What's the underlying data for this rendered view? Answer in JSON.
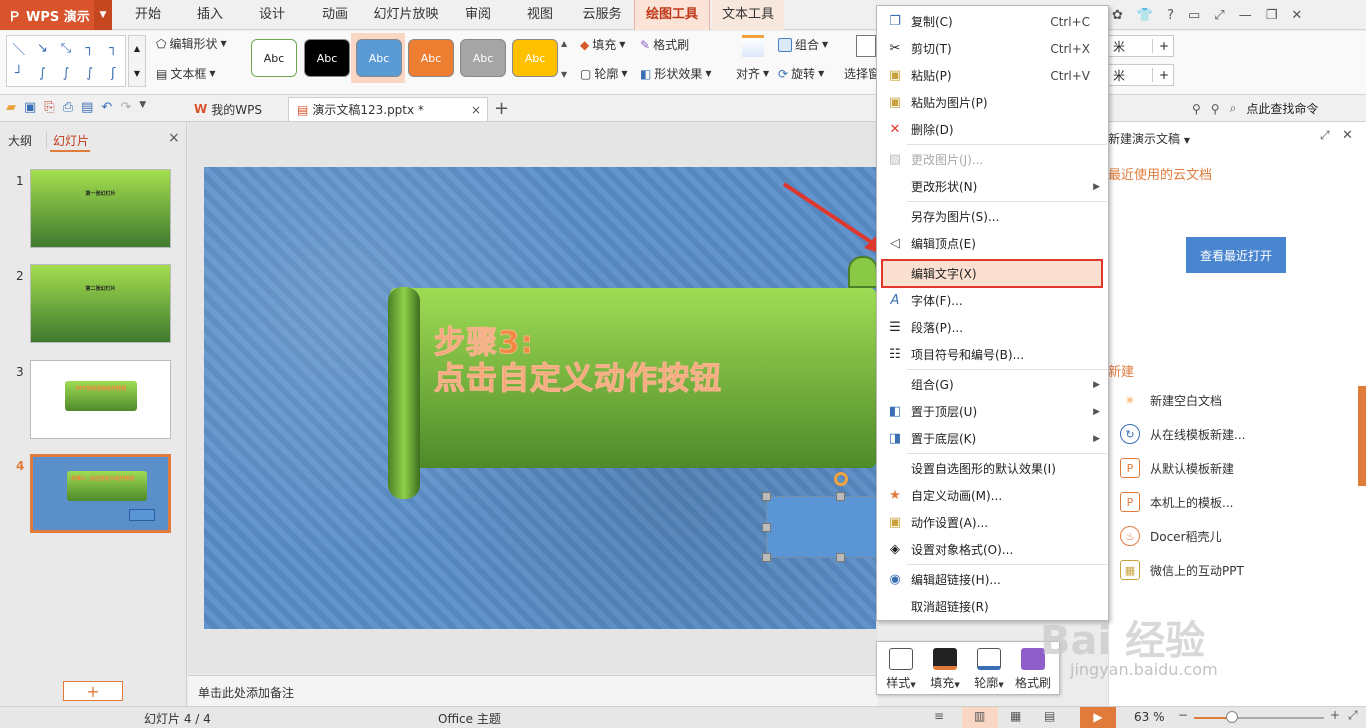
{
  "app": {
    "logo": "WPS 演示"
  },
  "menubar": {
    "tabs": [
      "开始",
      "插入",
      "设计",
      "动画",
      "幻灯片放映",
      "审阅",
      "视图",
      "云服务",
      "绘图工具",
      "文本工具"
    ]
  },
  "ribbon": {
    "edit_shape": "编辑形状",
    "textbox": "文本框",
    "styles": [
      "Abc",
      "Abc",
      "Abc",
      "Abc",
      "Abc",
      "Abc"
    ],
    "fill": "填充",
    "format_painter": "格式刷",
    "outline": "轮廓",
    "shape_effect": "形状效果",
    "align": "对齐",
    "group": "组合",
    "rotate": "旋转",
    "select": "选择窗",
    "unit1": "米",
    "unit2": "米",
    "plus": "+"
  },
  "tabstrip": {
    "mywps": "我的WPS",
    "doc": "演示文稿123.pptx *",
    "close": "×",
    "add": "+",
    "search": "点此查找命令"
  },
  "leftpanel": {
    "tab_outline": "大纲",
    "tab_slides": "幻灯片",
    "close": "×",
    "slides": [
      {
        "num": "1",
        "text": "第一张幻灯片"
      },
      {
        "num": "2",
        "text": "第二张幻灯片"
      },
      {
        "num": "3",
        "text": "PPT如何添加动作按钮"
      },
      {
        "num": "4",
        "text": "步骤3：点击自定义动作按钮"
      }
    ],
    "add": "+"
  },
  "slide": {
    "line1": "步骤3:",
    "line2": "点击自定义动作按钮"
  },
  "notes": {
    "placeholder": "单击此处添加备注"
  },
  "rightpanel": {
    "new_doc": "新建演示文稿",
    "recent_cloud": "最近使用的云文档",
    "view_recent": "查看最近打开",
    "new_section": "新建",
    "items": [
      "新建空白文档",
      "从在线模板新建...",
      "从默认模板新建",
      "本机上的模板...",
      "Docer稻壳儿",
      "微信上的互动PPT"
    ]
  },
  "ctxmenu": {
    "items": [
      {
        "label": "复制(C)",
        "shortcut": "Ctrl+C"
      },
      {
        "label": "剪切(T)",
        "shortcut": "Ctrl+X"
      },
      {
        "label": "粘贴(P)",
        "shortcut": "Ctrl+V"
      },
      {
        "label": "粘贴为图片(P)"
      },
      {
        "label": "删除(D)"
      },
      {
        "label": "更改图片(J)..."
      },
      {
        "label": "更改形状(N)"
      },
      {
        "label": "另存为图片(S)..."
      },
      {
        "label": "编辑顶点(E)"
      },
      {
        "label": "编辑文字(X)"
      },
      {
        "label": "字体(F)..."
      },
      {
        "label": "段落(P)..."
      },
      {
        "label": "项目符号和编号(B)..."
      },
      {
        "label": "组合(G)"
      },
      {
        "label": "置于顶层(U)"
      },
      {
        "label": "置于底层(K)"
      },
      {
        "label": "设置自选图形的默认效果(I)"
      },
      {
        "label": "自定义动画(M)..."
      },
      {
        "label": "动作设置(A)..."
      },
      {
        "label": "设置对象格式(O)..."
      },
      {
        "label": "编辑超链接(H)..."
      },
      {
        "label": "取消超链接(R)"
      }
    ]
  },
  "minitoolbar": {
    "style": "样式",
    "fill": "填充",
    "outline": "轮廓",
    "painter": "格式刷"
  },
  "statusbar": {
    "slide": "幻灯片 4 / 4",
    "theme": "Office 主题",
    "zoom": "63 %"
  },
  "watermark": {
    "main": "Bai 经验",
    "sub": "jingyan.baidu.com"
  }
}
